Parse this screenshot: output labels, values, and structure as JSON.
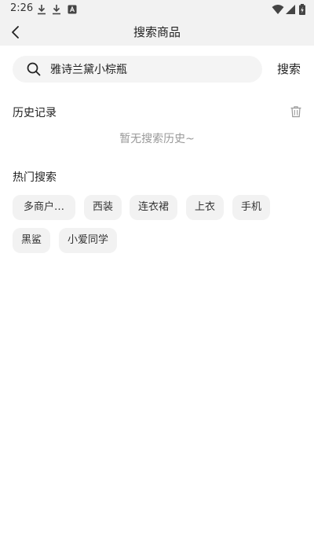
{
  "status_bar": {
    "time": "2:26"
  },
  "header": {
    "title": "搜索商品"
  },
  "search": {
    "value": "雅诗兰黛小棕瓶",
    "button_label": "搜索"
  },
  "history": {
    "title": "历史记录",
    "empty_text": "暂无搜索历史~"
  },
  "hot_search": {
    "title": "热门搜索",
    "tags": [
      "多商户…",
      "西装",
      "连衣裙",
      "上衣",
      "手机",
      "黑鲨",
      "小爱同学"
    ]
  },
  "colors": {
    "header_bg": "#f2f2f2",
    "tag_bg": "#f2f2f2",
    "muted_text": "#999999"
  },
  "icons": [
    "download-icon",
    "download-icon",
    "app-notification-icon",
    "wifi-icon",
    "signal-icon",
    "battery-icon",
    "back-arrow-icon",
    "search-icon",
    "trash-icon"
  ]
}
